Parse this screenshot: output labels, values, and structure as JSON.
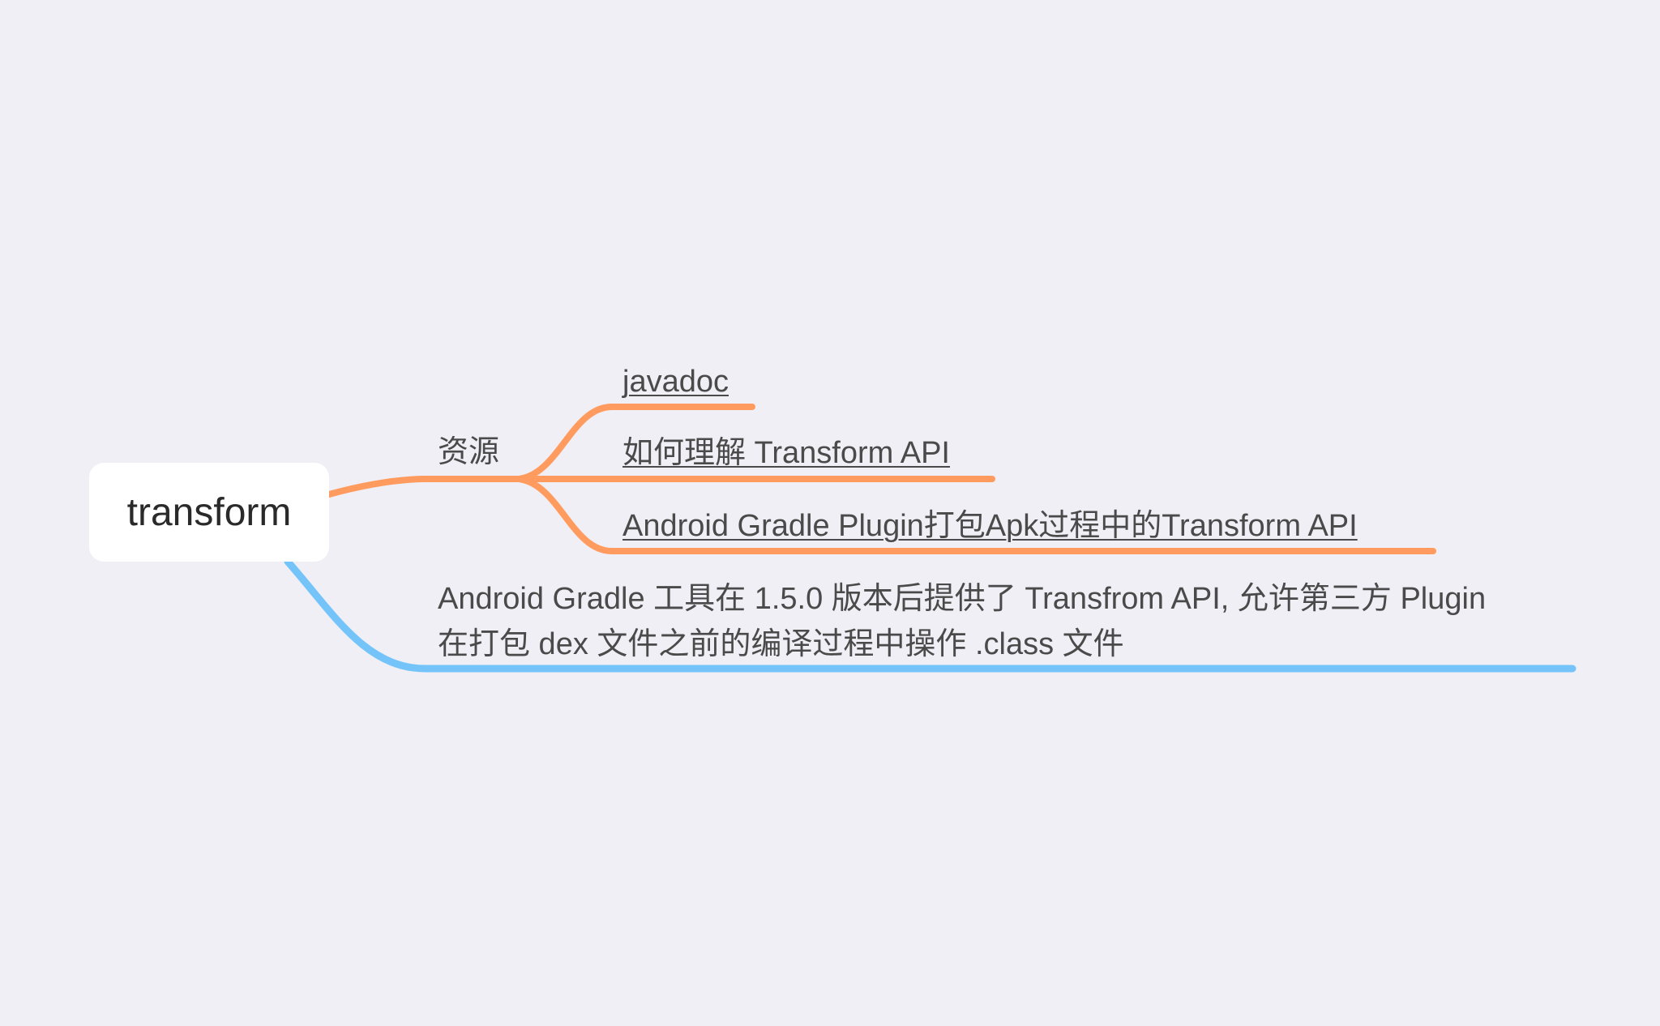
{
  "mindmap": {
    "root": {
      "label": "transform"
    },
    "branches": [
      {
        "label": "资源",
        "color": "#ff9b5e",
        "children": [
          {
            "label": "javadoc"
          },
          {
            "label": "如何理解 Transform API"
          },
          {
            "label": "Android Gradle Plugin打包Apk过程中的Transform API"
          }
        ]
      },
      {
        "lines": [
          "Android Gradle 工具在 1.5.0 版本后提供了 Transfrom API, 允许第三方 Plugin",
          "在打包 dex 文件之前的编译过程中操作 .class 文件"
        ],
        "color": "#74c4fa"
      }
    ]
  }
}
